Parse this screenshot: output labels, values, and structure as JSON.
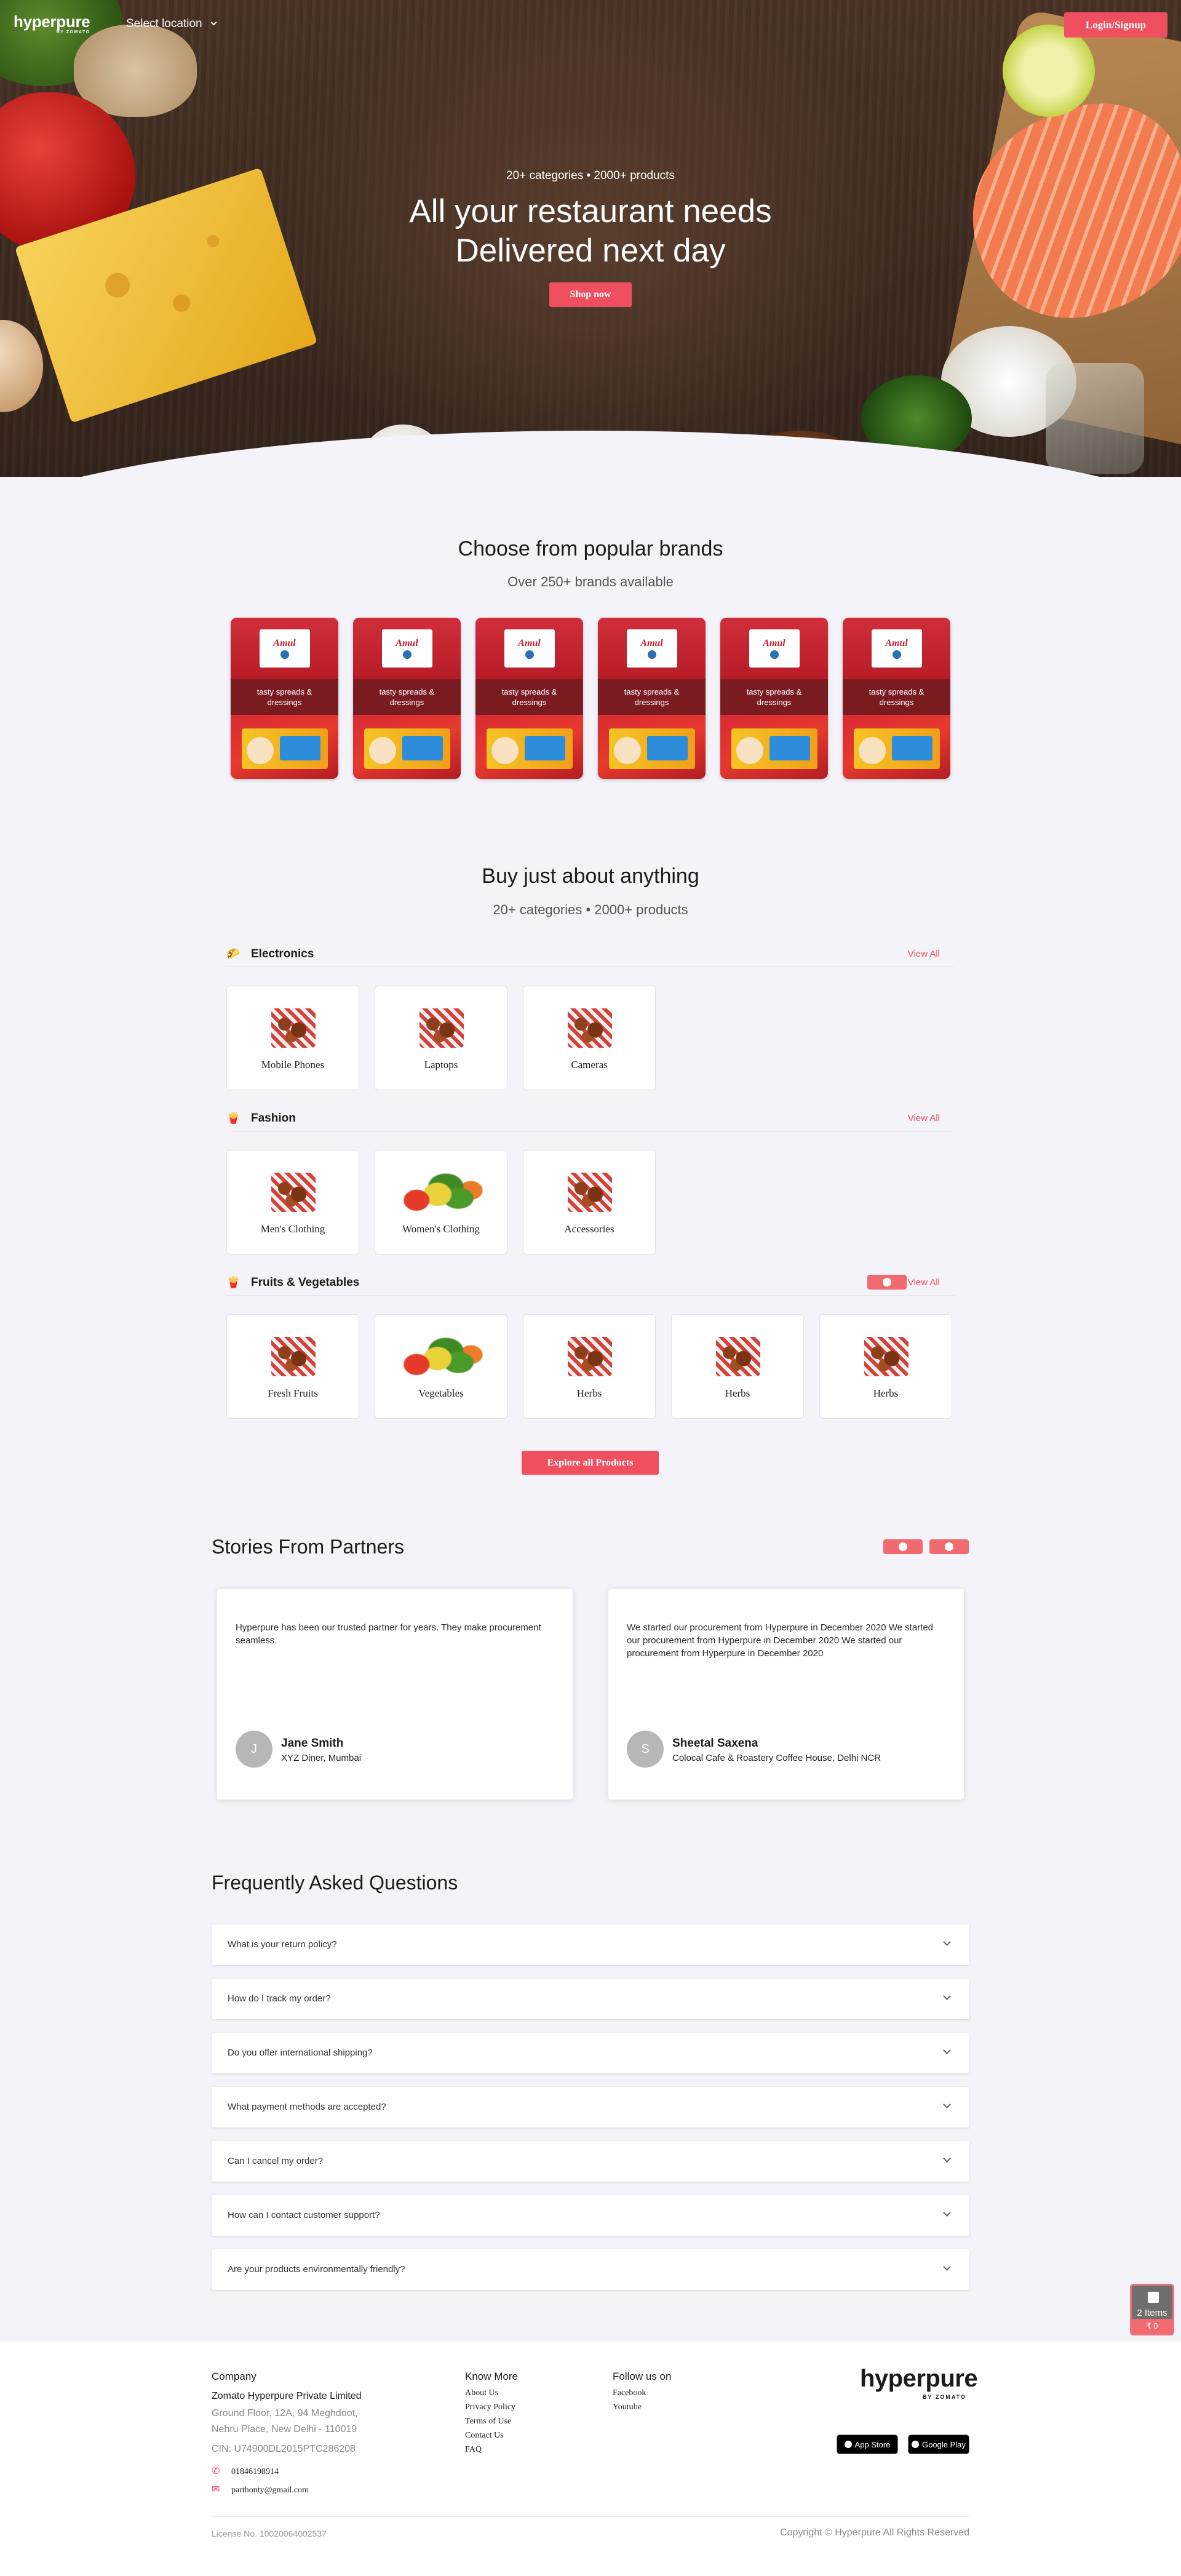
{
  "header": {
    "logo": "hyperpure",
    "logo_by": "BY ZOMATO",
    "location_label": "Select location",
    "login_label": "Login/Signup"
  },
  "hero": {
    "subtitle": "20+ categories • 2000+ products",
    "title_line1": "All your restaurant needs",
    "title_line2": "Delivered next day",
    "cta": "Shop now"
  },
  "brands": {
    "title": "Choose from popular brands",
    "subtitle": "Over 250+ brands available",
    "items": [
      {
        "logo": "Amul",
        "caption": "tasty spreads & dressings"
      },
      {
        "logo": "Amul",
        "caption": "tasty spreads & dressings"
      },
      {
        "logo": "Amul",
        "caption": "tasty spreads & dressings"
      },
      {
        "logo": "Amul",
        "caption": "tasty spreads & dressings"
      },
      {
        "logo": "Amul",
        "caption": "tasty spreads & dressings"
      },
      {
        "logo": "Amul",
        "caption": "tasty spreads & dressings"
      }
    ]
  },
  "catalog": {
    "title": "Buy just about anything",
    "subtitle": "20+ categories • 2000+ products",
    "view_all": "View All",
    "categories": [
      {
        "name": "Electronics",
        "items": [
          "Mobile Phones",
          "Laptops",
          "Cameras"
        ]
      },
      {
        "name": "Fashion",
        "items": [
          "Men's Clothing",
          "Women's Clothing",
          "Accessories"
        ]
      },
      {
        "name": "Fruits & Vegetables",
        "items": [
          "Fresh Fruits",
          "Vegetables",
          "Herbs",
          "Herbs",
          "Herbs"
        ]
      }
    ],
    "explore_label": "Explore all Products"
  },
  "stories": {
    "title": "Stories From Partners",
    "items": [
      {
        "quote": "Hyperpure has been our trusted partner for years. They make procurement seamless.",
        "initial": "J",
        "name": "Jane Smith",
        "place": "XYZ Diner, Mumbai"
      },
      {
        "quote": "We started our procurement from Hyperpure in December 2020 We started our procurement from Hyperpure in December 2020 We started our procurement from Hyperpure in December 2020",
        "initial": "S",
        "name": "Sheetal Saxena",
        "place": "Colocal Cafe & Roastery Coffee House, Delhi NCR"
      }
    ]
  },
  "faq": {
    "title": "Frequently Asked Questions",
    "items": [
      "What is your return policy?",
      "How do I track my order?",
      "Do you offer international shipping?",
      "What payment methods are accepted?",
      "Can I cancel my order?",
      "How can I contact customer support?",
      "Are your products environmentally friendly?"
    ]
  },
  "cart": {
    "items": "2 Items",
    "price": "₹ 0"
  },
  "footer": {
    "company_heading": "Company",
    "company_name": "Zomato Hyperpure Private Limited",
    "address_line1": "Ground Floor, 12A, 94 Meghdoot,",
    "address_line2": "Nehru Place, New Delhi - 110019",
    "cin": "CIN: U74900DL2015PTC286208",
    "phone": "01846198914",
    "email": "parthonty@gmail.com",
    "know_more_heading": "Know More",
    "know_more_links": [
      "About Us",
      "Privacy Policy",
      "Terms of Use",
      "Contact Us",
      "FAQ"
    ],
    "follow_heading": "Follow us on",
    "follow_links": [
      "Facebook",
      "Youtube"
    ],
    "logo": "hyperpure",
    "logo_by": "BY ZOMATO",
    "app_store": "App Store",
    "google_play": "Google Play",
    "license": "License No. 10020064002537",
    "copyright": "Copyright © Hyperpure All Rights Reserved"
  },
  "colors": {
    "accent": "#ef4f5f",
    "background": "#f3f3f9"
  }
}
